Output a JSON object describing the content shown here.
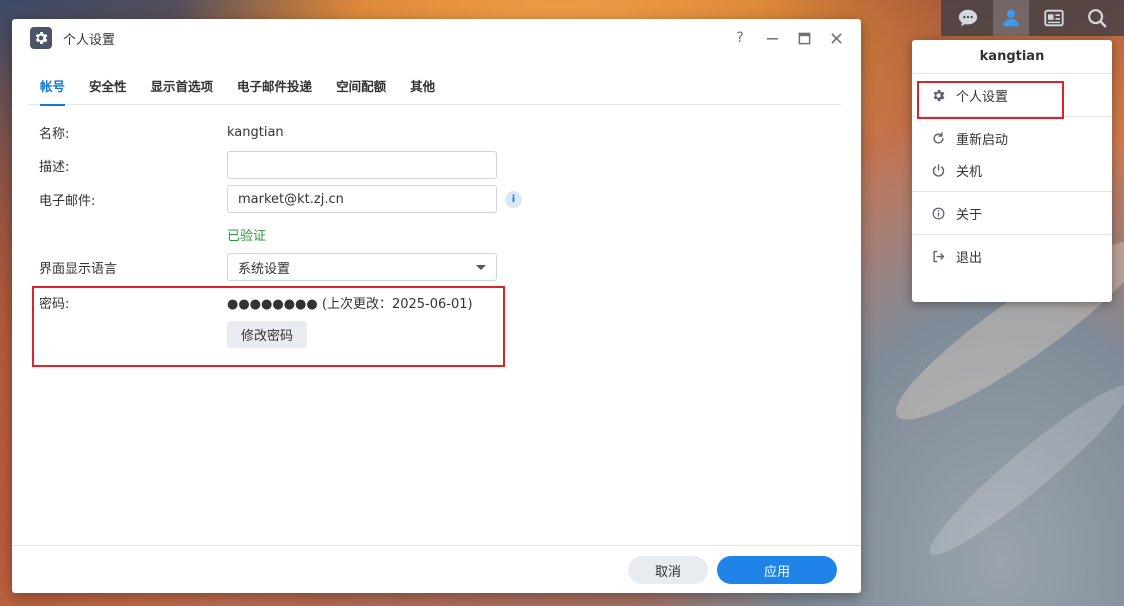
{
  "tray": {
    "icons": [
      "chat-icon",
      "user-icon",
      "widgets-icon",
      "search-icon"
    ]
  },
  "user_menu": {
    "username": "kangtian",
    "items": [
      {
        "label": "个人设置",
        "icon": "gear-icon"
      },
      {
        "label": "重新启动",
        "icon": "restart-icon"
      },
      {
        "label": "关机",
        "icon": "power-icon"
      },
      {
        "label": "关于",
        "icon": "info-icon"
      },
      {
        "label": "退出",
        "icon": "logout-icon"
      }
    ]
  },
  "dialog": {
    "title": "个人设置",
    "controls": {
      "help": "?",
      "minimize": "—",
      "maximize": "□",
      "close": "✕"
    },
    "tabs": [
      "帐号",
      "安全性",
      "显示首选项",
      "电子邮件投递",
      "空间配额",
      "其他"
    ],
    "active_tab": "帐号",
    "form": {
      "name_label": "名称:",
      "name_value": "kangtian",
      "desc_label": "描述:",
      "desc_value": "",
      "email_label": "电子邮件:",
      "email_value": "market@kt.zj.cn",
      "email_status": "已验证",
      "lang_label": "界面显示语言",
      "lang_value": "系统设置",
      "pwd_label": "密码:",
      "pwd_value": "●●●●●●●● (上次更改：2025-06-01)",
      "pwd_button": "修改密码"
    },
    "footer": {
      "cancel": "取消",
      "apply": "应用"
    }
  },
  "colors": {
    "accent": "#1479d4",
    "apply_button": "#1e84e8",
    "verified": "#2a9a3a",
    "highlight": "#d9232e"
  }
}
